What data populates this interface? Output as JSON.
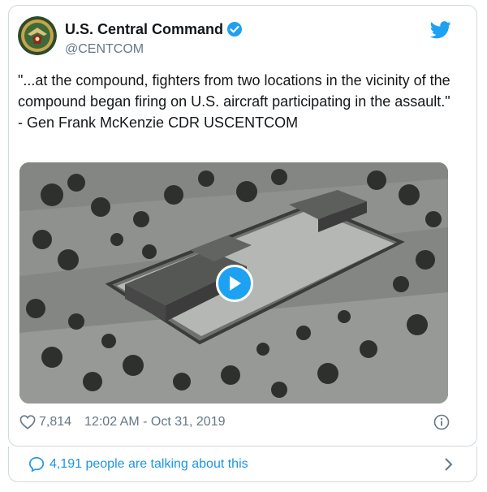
{
  "account": {
    "name": "U.S. Central Command",
    "handle": "@CENTCOM",
    "verified": true,
    "avatar_icon": "centcom-seal-icon"
  },
  "brand": {
    "icon": "twitter-bird-icon",
    "color": "#1da1f2"
  },
  "tweet": {
    "lines": [
      "\"...at the compound, fighters from two locations in the vicinity of the compound began firing on U.S. aircraft participating in the assault.\"",
      "- Gen Frank McKenzie CDR USCENTCOM"
    ]
  },
  "media": {
    "type": "video",
    "description_icon": "play-button-icon"
  },
  "meta": {
    "likes": "7,814",
    "timestamp": "12:02 AM - Oct 31, 2019"
  },
  "footer": {
    "talking": "4,191 people are talking about this"
  },
  "colors": {
    "link": "#1b95e0",
    "muted": "#657786",
    "border": "#cfd9de"
  }
}
